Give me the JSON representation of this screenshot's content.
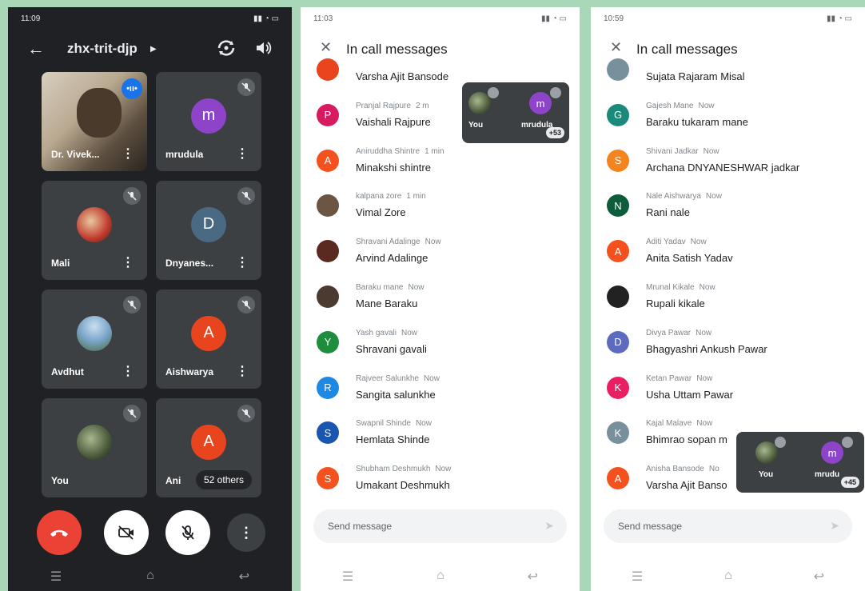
{
  "phone1": {
    "status_time": "11:09",
    "meeting_title": "zhx-trit-djp",
    "tiles": [
      {
        "name": "Dr. Vivek...",
        "type": "video"
      },
      {
        "name": "mrudula",
        "initial": "m",
        "color": "#8e44c9"
      },
      {
        "name": "Mali",
        "type": "photo",
        "color": "#c0392b"
      },
      {
        "name": "Dnyanes...",
        "initial": "D",
        "color": "#4a6a84"
      },
      {
        "name": "Avdhut",
        "type": "photo",
        "color": "#7aa4c8"
      },
      {
        "name": "Aishwarya",
        "initial": "A",
        "color": "#e8451e"
      },
      {
        "name": "You",
        "type": "photo",
        "color": "#4a5a3a"
      },
      {
        "name": "Ani",
        "initial": "A",
        "color": "#e8451e",
        "others": "52 others"
      }
    ],
    "controls": [
      "end-call",
      "camera-off",
      "mic-off",
      "more"
    ]
  },
  "phone2": {
    "status_time": "11:03",
    "header": "In call messages",
    "messages": [
      {
        "sender": "",
        "time": "",
        "text": "Varsha Ajit Bansode",
        "initial": "",
        "color": "#e8451e"
      },
      {
        "sender": "Pranjal Rajpure",
        "time": "2 m",
        "text": "Vaishali Rajpure",
        "initial": "P",
        "color": "#d81b60"
      },
      {
        "sender": "Aniruddha Shintre",
        "time": "1 min",
        "text": "Minakshi shintre",
        "initial": "A",
        "color": "#f4511e"
      },
      {
        "sender": "kalpana zore",
        "time": "1 min",
        "text": "Vimal Zore",
        "initial": "",
        "color": "#6d5544"
      },
      {
        "sender": "Shravani Adalinge",
        "time": "Now",
        "text": "Arvind Adalinge",
        "initial": "",
        "color": "#5a2a20"
      },
      {
        "sender": "Baraku mane",
        "time": "Now",
        "text": "Mane Baraku",
        "initial": "",
        "color": "#4a3a30"
      },
      {
        "sender": "Yash gavali",
        "time": "Now",
        "text": "Shravani gavali",
        "initial": "Y",
        "color": "#1e8e3e"
      },
      {
        "sender": "Rajveer Salunkhe",
        "time": "Now",
        "text": "Sangita salunkhe",
        "initial": "R",
        "color": "#1e88e5"
      },
      {
        "sender": "Swapnil Shinde",
        "time": "Now",
        "text": "Hemlata Shinde",
        "initial": "S",
        "color": "#1a56b0"
      },
      {
        "sender": "Shubham Deshmukh",
        "time": "Now",
        "text": "Umakant Deshmukh",
        "initial": "S",
        "color": "#f4511e"
      }
    ],
    "pip": {
      "you": "You",
      "other": "mrudula",
      "other_initial": "m",
      "badge": "+53"
    },
    "send_placeholder": "Send message"
  },
  "phone3": {
    "status_time": "10:59",
    "header": "In call messages",
    "messages": [
      {
        "sender": "",
        "time": "",
        "text": "Sujata Rajaram Misal",
        "initial": "",
        "color": "#78909c"
      },
      {
        "sender": "Gajesh Mane",
        "time": "Now",
        "text": "Baraku tukaram mane",
        "initial": "G",
        "color": "#1a8a7a"
      },
      {
        "sender": "Shivani Jadkar",
        "time": "Now",
        "text": "Archana DNYANESHWAR jadkar",
        "initial": "S",
        "color": "#f4841e"
      },
      {
        "sender": "Nale Aishwarya",
        "time": "Now",
        "text": "Rani nale",
        "initial": "N",
        "color": "#0d5c3a"
      },
      {
        "sender": "Aditi Yadav",
        "time": "Now",
        "text": "Anita Satish Yadav",
        "initial": "A",
        "color": "#f4511e"
      },
      {
        "sender": "Mrunal Kikale",
        "time": "Now",
        "text": "Rupali kikale",
        "initial": "",
        "color": "#222222"
      },
      {
        "sender": "Divya Pawar",
        "time": "Now",
        "text": "Bhagyashri Ankush Pawar",
        "initial": "D",
        "color": "#5c6bc0"
      },
      {
        "sender": "Ketan Pawar",
        "time": "Now",
        "text": "Usha Uttam Pawar",
        "initial": "K",
        "color": "#e91e63"
      },
      {
        "sender": "Kajal Malave",
        "time": "Now",
        "text": "Bhimrao sopan m",
        "initial": "K",
        "color": "#78909c"
      },
      {
        "sender": "Anisha Bansode",
        "time": "No",
        "text": "Varsha Ajit Banso",
        "initial": "A",
        "color": "#f4511e"
      }
    ],
    "pip": {
      "you": "You",
      "other": "mrudu",
      "other_initial": "m",
      "badge": "+45"
    },
    "send_placeholder": "Send message"
  }
}
